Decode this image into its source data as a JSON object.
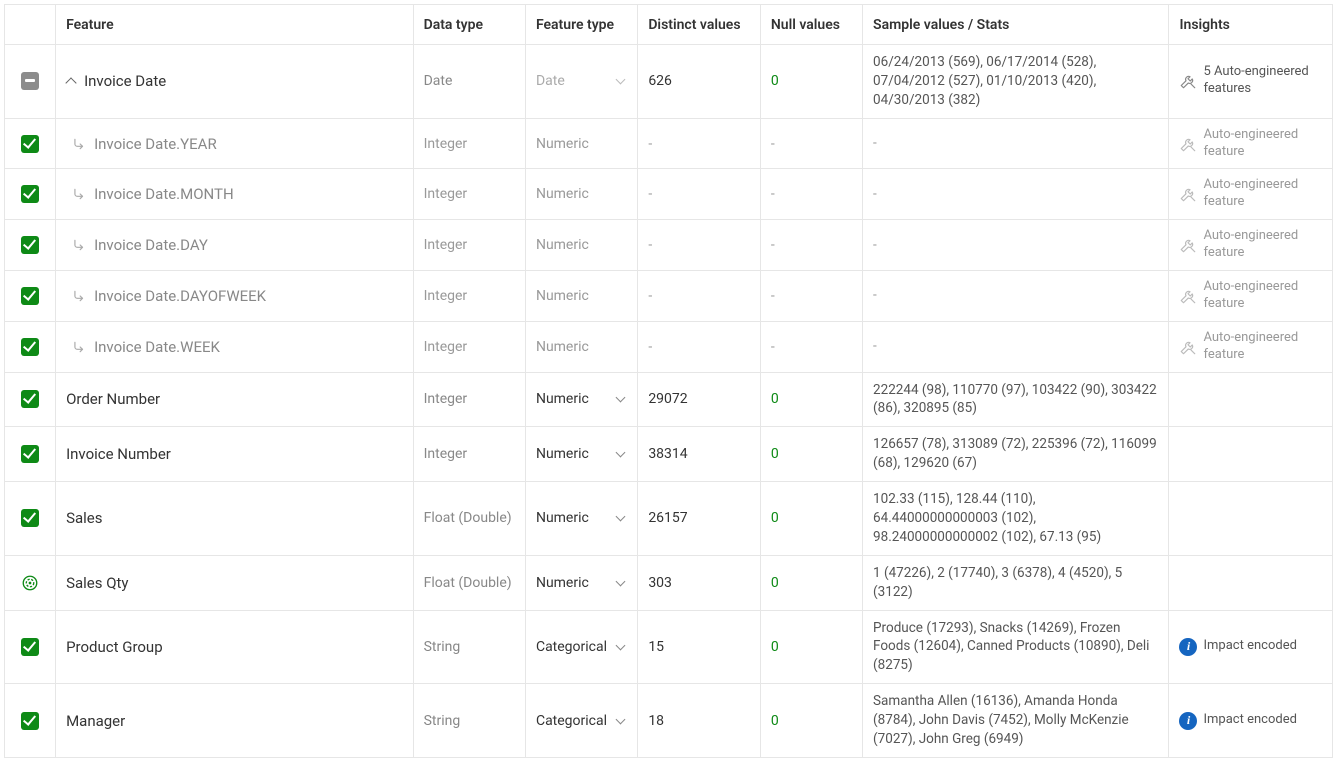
{
  "headers": {
    "feature": "Feature",
    "dataType": "Data type",
    "featureType": "Feature type",
    "distinct": "Distinct values",
    "nulls": "Null values",
    "sample": "Sample values / Stats",
    "insights": "Insights"
  },
  "rows": [
    {
      "check": "indeterminate",
      "expand": true,
      "name": "Invoice Date",
      "dataType": "Date",
      "featureType": "Date",
      "featureTypeSelectable": true,
      "featureTypeDisabled": true,
      "distinct": "626",
      "nulls": "0",
      "sample": "06/24/2013 (569), 06/17/2014 (528), 07/04/2012 (527), 01/10/2013 (420), 04/30/2013 (382)",
      "insight": {
        "icon": "wrench",
        "text": "5 Auto-engineered features"
      }
    },
    {
      "check": "checked",
      "sub": true,
      "name": "Invoice Date.YEAR",
      "dataType": "Integer",
      "featureType": "Numeric",
      "featureTypeSelectable": false,
      "distinct": "-",
      "nulls": "-",
      "sample": "-",
      "insight": {
        "icon": "wrench",
        "text": "Auto-engineered feature",
        "muted": true
      }
    },
    {
      "check": "checked",
      "sub": true,
      "name": "Invoice Date.MONTH",
      "dataType": "Integer",
      "featureType": "Numeric",
      "featureTypeSelectable": false,
      "distinct": "-",
      "nulls": "-",
      "sample": "-",
      "insight": {
        "icon": "wrench",
        "text": "Auto-engineered feature",
        "muted": true
      }
    },
    {
      "check": "checked",
      "sub": true,
      "name": "Invoice Date.DAY",
      "dataType": "Integer",
      "featureType": "Numeric",
      "featureTypeSelectable": false,
      "distinct": "-",
      "nulls": "-",
      "sample": "-",
      "insight": {
        "icon": "wrench",
        "text": "Auto-engineered feature",
        "muted": true
      }
    },
    {
      "check": "checked",
      "sub": true,
      "name": "Invoice Date.DAYOFWEEK",
      "dataType": "Integer",
      "featureType": "Numeric",
      "featureTypeSelectable": false,
      "distinct": "-",
      "nulls": "-",
      "sample": "-",
      "insight": {
        "icon": "wrench",
        "text": "Auto-engineered feature",
        "muted": true
      }
    },
    {
      "check": "checked",
      "sub": true,
      "name": "Invoice Date.WEEK",
      "dataType": "Integer",
      "featureType": "Numeric",
      "featureTypeSelectable": false,
      "distinct": "-",
      "nulls": "-",
      "sample": "-",
      "insight": {
        "icon": "wrench",
        "text": "Auto-engineered feature",
        "muted": true
      }
    },
    {
      "check": "checked",
      "name": "Order Number",
      "dataType": "Integer",
      "featureType": "Numeric",
      "featureTypeSelectable": true,
      "distinct": "29072",
      "nulls": "0",
      "sample": "222244 (98), 110770 (97), 103422 (90), 303422 (86), 320895 (85)"
    },
    {
      "check": "checked",
      "name": "Invoice Number",
      "dataType": "Integer",
      "featureType": "Numeric",
      "featureTypeSelectable": true,
      "distinct": "38314",
      "nulls": "0",
      "sample": "126657 (78), 313089 (72), 225396 (72), 116099 (68), 129620 (67)"
    },
    {
      "check": "checked",
      "name": "Sales",
      "dataType": "Float (Double)",
      "featureType": "Numeric",
      "featureTypeSelectable": true,
      "distinct": "26157",
      "nulls": "0",
      "sample": "102.33 (115), 128.44 (110), 64.44000000000003 (102), 98.24000000000002 (102), 67.13 (95)"
    },
    {
      "check": "target",
      "name": "Sales Qty",
      "dataType": "Float (Double)",
      "featureType": "Numeric",
      "featureTypeSelectable": true,
      "distinct": "303",
      "nulls": "0",
      "sample": "1 (47226), 2 (17740), 3 (6378), 4 (4520), 5 (3122)"
    },
    {
      "check": "checked",
      "name": "Product Group",
      "dataType": "String",
      "featureType": "Categorical",
      "featureTypeSelectable": true,
      "distinct": "15",
      "nulls": "0",
      "sample": "Produce (17293), Snacks (14269), Frozen Foods (12604), Canned Products (10890), Deli (8275)",
      "insight": {
        "icon": "info",
        "text": "Impact encoded"
      }
    },
    {
      "check": "checked",
      "name": "Manager",
      "dataType": "String",
      "featureType": "Categorical",
      "featureTypeSelectable": true,
      "distinct": "18",
      "nulls": "0",
      "sample": "Samantha Allen (16136), Amanda Honda (8784), John Davis (7452), Molly McKenzie (7027), John Greg (6949)",
      "insight": {
        "icon": "info",
        "text": "Impact encoded"
      }
    }
  ]
}
